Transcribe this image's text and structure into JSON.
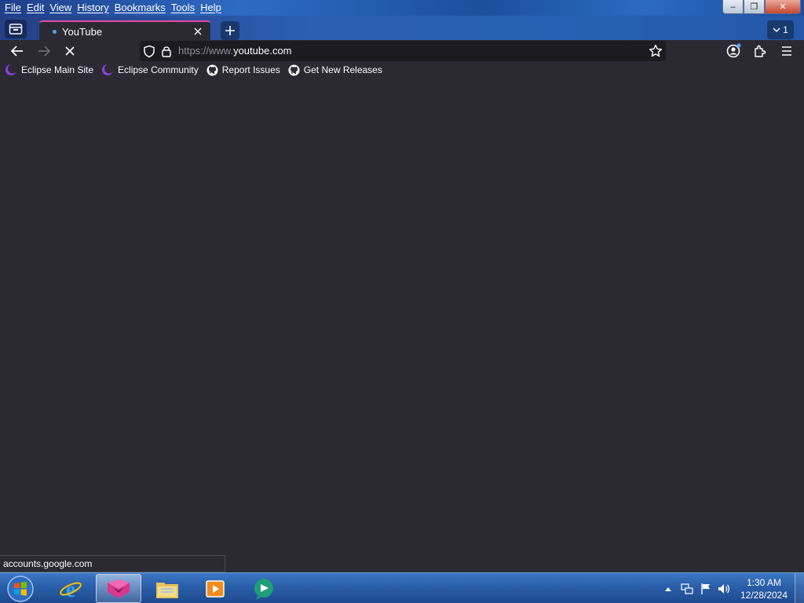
{
  "menu": {
    "items": [
      "File",
      "Edit",
      "View",
      "History",
      "Bookmarks",
      "Tools",
      "Help"
    ]
  },
  "window_controls": {
    "minimize": "–",
    "restore": "❐",
    "close": "✕"
  },
  "tabs": {
    "active_title": "YouTube",
    "tab_count": "1"
  },
  "urlbar": {
    "scheme": "https://www.",
    "host": "youtube.com"
  },
  "bookmarks": [
    {
      "label": "Eclipse Main Site",
      "icon": "eclipse-icon"
    },
    {
      "label": "Eclipse Community",
      "icon": "eclipse-icon"
    },
    {
      "label": "Report Issues",
      "icon": "github-icon"
    },
    {
      "label": "Get New Releases",
      "icon": "github-icon"
    }
  ],
  "status": {
    "text": "accounts.google.com"
  },
  "taskbar": {
    "apps": [
      "internet-explorer-icon",
      "browser-icon",
      "file-explorer-icon",
      "media-player-icon",
      "chat-app-icon"
    ]
  },
  "clock": {
    "time": "1:30 AM",
    "date": "12/28/2024"
  },
  "colors": {
    "toolbar": "#2b2a33",
    "urlbar": "#1c1b22",
    "tab_accent": "#e24aa3",
    "text": "#fbfbfe"
  }
}
